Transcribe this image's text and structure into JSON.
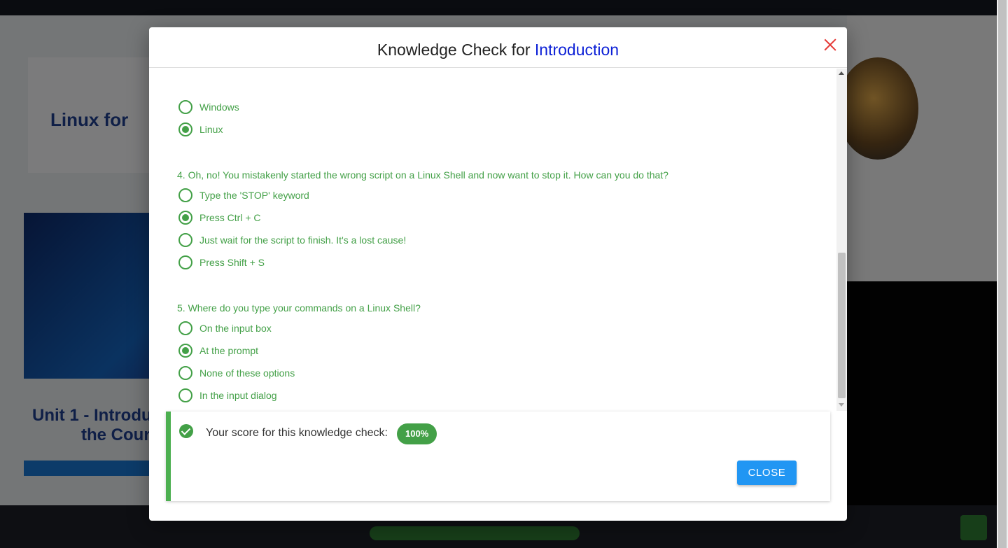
{
  "modal": {
    "title_prefix": "Knowledge Check for ",
    "title_highlight": "Introduction",
    "close_icon": "close-x-icon",
    "accent_color": "#0b1fd6",
    "close_color": "#e53935"
  },
  "questions": [
    {
      "partial": true,
      "options": [
        {
          "label": "Windows",
          "selected": false
        },
        {
          "label": "Linux",
          "selected": true
        }
      ]
    },
    {
      "text": "4. Oh, no! You mistakenly started the wrong script on a Linux Shell and now want to stop it. How can you do that?",
      "options": [
        {
          "label": "Type the 'STOP' keyword",
          "selected": false
        },
        {
          "label": "Press Ctrl + C",
          "selected": true
        },
        {
          "label": "Just wait for the script to finish. It's a lost cause!",
          "selected": false
        },
        {
          "label": "Press Shift + S",
          "selected": false
        }
      ]
    },
    {
      "text": "5. Where do you type your commands on a Linux Shell?",
      "options": [
        {
          "label": "On the input box",
          "selected": false
        },
        {
          "label": "At the prompt",
          "selected": true
        },
        {
          "label": "None of these options",
          "selected": false
        },
        {
          "label": "In the input dialog",
          "selected": false
        }
      ]
    }
  ],
  "result": {
    "text": "Your score for this knowledge check:",
    "score": "100%",
    "close_label": "CLOSE",
    "icon": "check-circle-icon",
    "success_color": "#43a047",
    "button_color": "#2196f3"
  }
}
